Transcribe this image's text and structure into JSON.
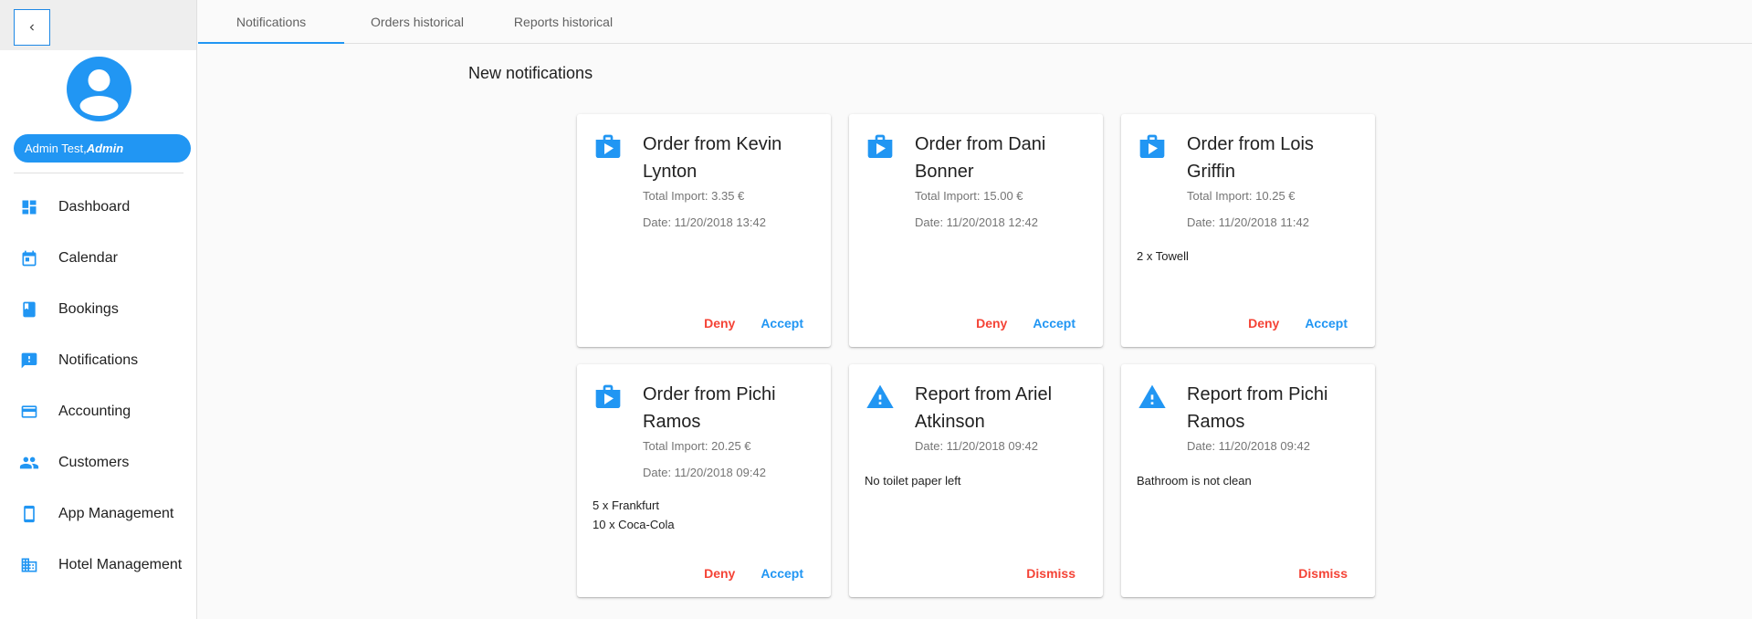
{
  "colors": {
    "primary": "#2196f3",
    "danger": "#f44336",
    "text": "#212121",
    "muted": "#757575"
  },
  "user": {
    "name": "Admin Test,",
    "role": "Admin"
  },
  "sidebar": {
    "items": [
      {
        "label": "Dashboard",
        "icon": "dashboard-icon"
      },
      {
        "label": "Calendar",
        "icon": "calendar-icon"
      },
      {
        "label": "Bookings",
        "icon": "book-icon"
      },
      {
        "label": "Notifications",
        "icon": "feedback-icon"
      },
      {
        "label": "Accounting",
        "icon": "credit-card-icon"
      },
      {
        "label": "Customers",
        "icon": "people-icon"
      },
      {
        "label": "App Management",
        "icon": "phone-icon"
      },
      {
        "label": "Hotel Management",
        "icon": "building-icon"
      }
    ]
  },
  "tabs": [
    {
      "label": "Notifications",
      "active": true
    },
    {
      "label": "Orders historical",
      "active": false
    },
    {
      "label": "Reports historical",
      "active": false
    }
  ],
  "main": {
    "title": "New notifications",
    "cards": [
      {
        "type": "order",
        "title": "Order from Kevin Lynton",
        "import": "Total Import: 3.35 €",
        "date": "Date: 11/20/2018 13:42",
        "lines": [],
        "deny": "Deny",
        "accept": "Accept"
      },
      {
        "type": "order",
        "title": "Order from Dani Bonner",
        "import": "Total Import: 15.00 €",
        "date": "Date: 11/20/2018 12:42",
        "lines": [],
        "deny": "Deny",
        "accept": "Accept"
      },
      {
        "type": "order",
        "title": "Order from Lois Griffin",
        "import": "Total Import: 10.25 €",
        "date": "Date: 11/20/2018 11:42",
        "lines": [
          "2 x Towell"
        ],
        "deny": "Deny",
        "accept": "Accept"
      },
      {
        "type": "order",
        "title": "Order from Pichi Ramos",
        "import": "Total Import: 20.25 €",
        "date": "Date: 11/20/2018 09:42",
        "lines": [
          "5 x Frankfurt",
          "10 x Coca-Cola"
        ],
        "deny": "Deny",
        "accept": "Accept"
      },
      {
        "type": "report",
        "title": "Report from Ariel Atkinson",
        "date": "Date: 11/20/2018 09:42",
        "lines": [
          "No toilet paper left"
        ],
        "dismiss": "Dismiss"
      },
      {
        "type": "report",
        "title": "Report from Pichi Ramos",
        "date": "Date: 11/20/2018 09:42",
        "lines": [
          "Bathroom is not clean"
        ],
        "dismiss": "Dismiss"
      }
    ]
  }
}
